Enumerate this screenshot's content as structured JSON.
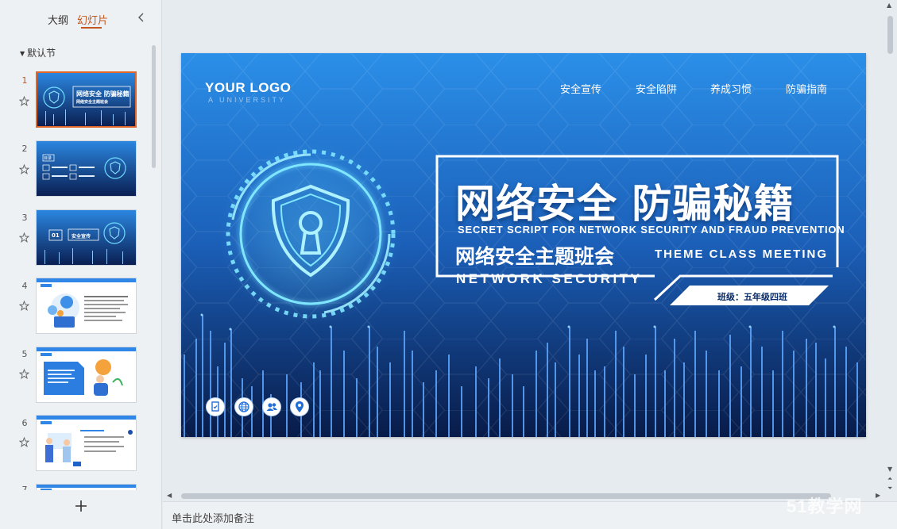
{
  "left_panel": {
    "tabs": [
      {
        "label": "大纲"
      },
      {
        "label": "幻灯片"
      }
    ],
    "section_name": "默认节",
    "thumbnails": [
      {
        "number": "1",
        "title": "网络安全 防骗秘籍",
        "subtitle": "网络安全主题班会",
        "selected": true
      },
      {
        "number": "2",
        "title": "目录",
        "selected": false
      },
      {
        "number": "3",
        "title": "安全宣传",
        "badge": "01",
        "selected": false
      },
      {
        "number": "4",
        "selected": false
      },
      {
        "number": "5",
        "selected": false
      },
      {
        "number": "6",
        "selected": false
      },
      {
        "number": "7",
        "selected": false
      }
    ],
    "add_slide_label": "+"
  },
  "slide": {
    "logo": "YOUR LOGO",
    "logo_sub": "A UNIVERSITY",
    "nav": [
      "安全宣传",
      "安全陷阱",
      "养成习惯",
      "防骗指南"
    ],
    "title_cn": "网络安全 防骗秘籍",
    "title_en": "SECRET SCRIPT FOR NETWORK SECURITY AND FRAUD PREVENTION",
    "subtitle_cn": "网络安全主题班会",
    "subtitle_en": "THEME CLASS MEETING",
    "network_security": "NETWORK SECURITY",
    "class_label": "班级：五年级四班",
    "bottom_icons": [
      "checklist-icon",
      "globe-icon",
      "users-icon",
      "location-pin-icon"
    ]
  },
  "notes": {
    "placeholder": "单击此处添加备注"
  },
  "watermark": "51教学网",
  "colors": {
    "accent": "#e0662a",
    "slide_top": "#2b8fe8",
    "slide_bottom": "#0a1f52",
    "glow": "#5cd6ff"
  }
}
